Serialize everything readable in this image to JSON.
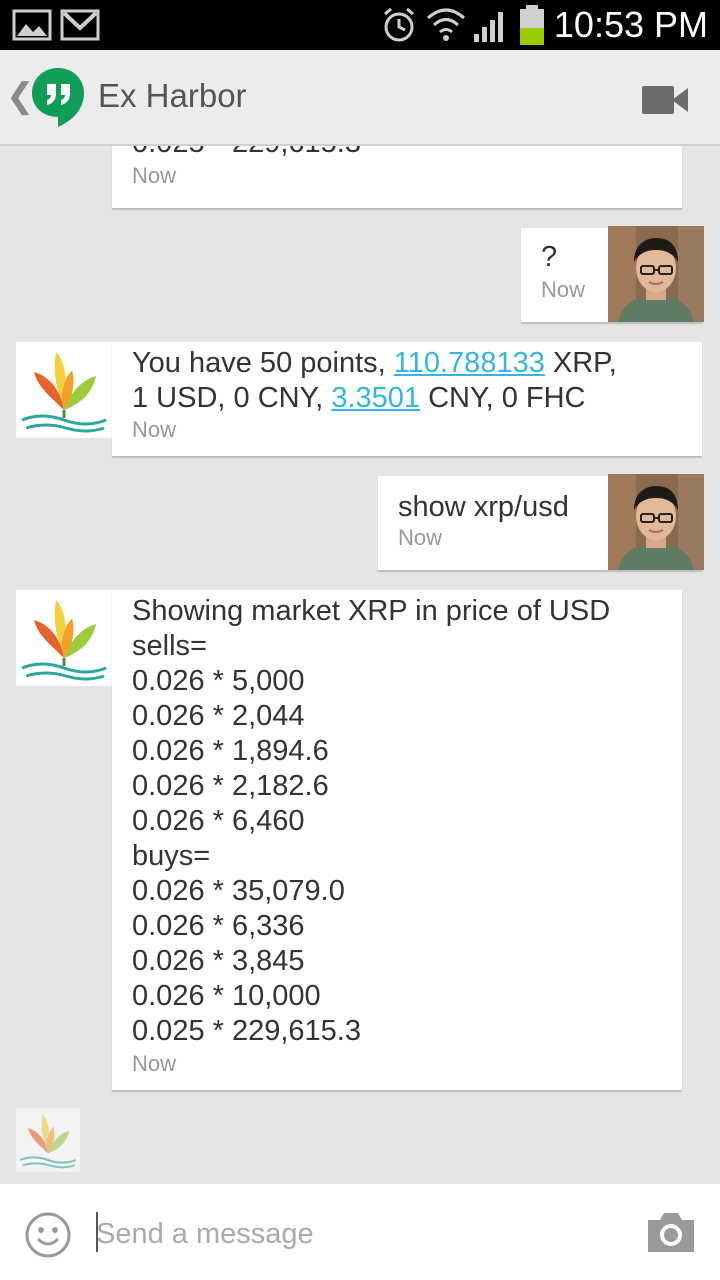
{
  "status_bar": {
    "time": "10:53 PM"
  },
  "header": {
    "title": "Ex Harbor",
    "back_icon": "chevron-left-icon",
    "logo_icon": "hangouts-logo-icon",
    "video_icon": "video-call-icon"
  },
  "messages": [
    {
      "from": "bot",
      "text": "0.025 * 229,615.3",
      "time": "Now"
    },
    {
      "from": "user",
      "text": "?",
      "time": "Now"
    },
    {
      "from": "bot",
      "line1_a": "You have 50 points, ",
      "line1_link": "110.788133",
      "line1_b": " XRP,",
      "line2_a": "1 USD, 0 CNY, ",
      "line2_link": "3.3501",
      "line2_b": " CNY, 0 FHC",
      "time": "Now"
    },
    {
      "from": "user",
      "text": "show xrp/usd",
      "time": "Now"
    },
    {
      "from": "bot",
      "text": "Showing market XRP in price of USD\nsells=\n0.026 * 5,000\n0.026 * 2,044\n0.026 * 1,894.6\n0.026 * 2,182.6\n0.026 * 6,460\nbuys=\n0.026 * 35,079.0\n0.026 * 6,336\n0.026 * 3,845\n0.026 * 10,000\n0.025 * 229,615.3",
      "time": "Now"
    }
  ],
  "composer": {
    "placeholder": "Send a message",
    "emoji_icon": "emoji-icon",
    "camera_icon": "camera-icon"
  },
  "colors": {
    "link": "#33b5e5",
    "hangouts_green": "#0f9d58",
    "status_bar": "#000000",
    "battery": "#99cc00"
  }
}
